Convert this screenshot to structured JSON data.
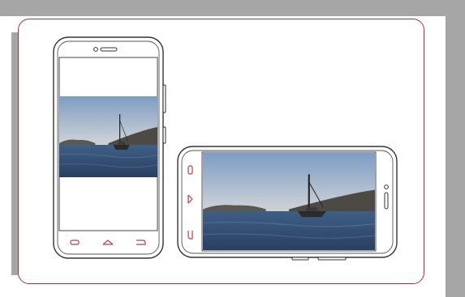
{
  "illustration": {
    "subject": "smartphone-orientation",
    "colors": {
      "frame_gray": "#a6a6a6",
      "card_border": "#a8314a",
      "nav_key_color": "#c0394f",
      "outline": "#333333"
    },
    "portrait_nav_icons": [
      "recent-apps-icon",
      "home-icon",
      "back-icon"
    ],
    "landscape_nav_icons": [
      "recent-apps-icon",
      "home-icon",
      "back-icon"
    ]
  }
}
